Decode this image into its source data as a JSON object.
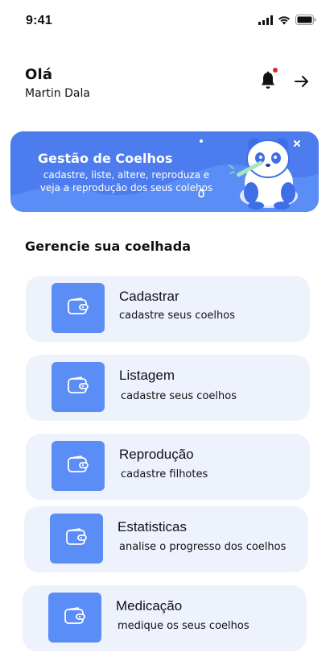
{
  "status_bar": {
    "time": "9:41",
    "icons": [
      "signal-icon",
      "wifi-icon",
      "battery-icon"
    ]
  },
  "header": {
    "greeting": "Olá",
    "user_name": "Martin Dala",
    "notification_icon": "bell-icon",
    "logout_icon": "arrow-right-icon",
    "notification_dot_color": "#e3262c"
  },
  "banner": {
    "title": "Gestão de Coelhos",
    "subtitle": "cadastre, liste, altere, reproduza e veja a reprodução dos seus colehos",
    "background": "#5b8df7"
  },
  "section": {
    "title": "Gerencie sua coelhada"
  },
  "menu": [
    {
      "title": "Cadastrar",
      "subtitle": "cadastre seus coelhos",
      "icon": "wallet-icon"
    },
    {
      "title": "Listagem",
      "subtitle": "cadastre seus coelhos",
      "icon": "wallet-icon"
    },
    {
      "title": "Reprodução",
      "subtitle": "cadastre filhotes",
      "icon": "wallet-icon"
    },
    {
      "title": "Estatisticas",
      "subtitle": "analise o progresso dos coelhos",
      "icon": "wallet-icon"
    },
    {
      "title": "Medicação",
      "subtitle": "medique os seus coelhos",
      "icon": "wallet-icon"
    }
  ],
  "colors": {
    "accent": "#5b8df7",
    "card_background": "#eef2fd"
  }
}
